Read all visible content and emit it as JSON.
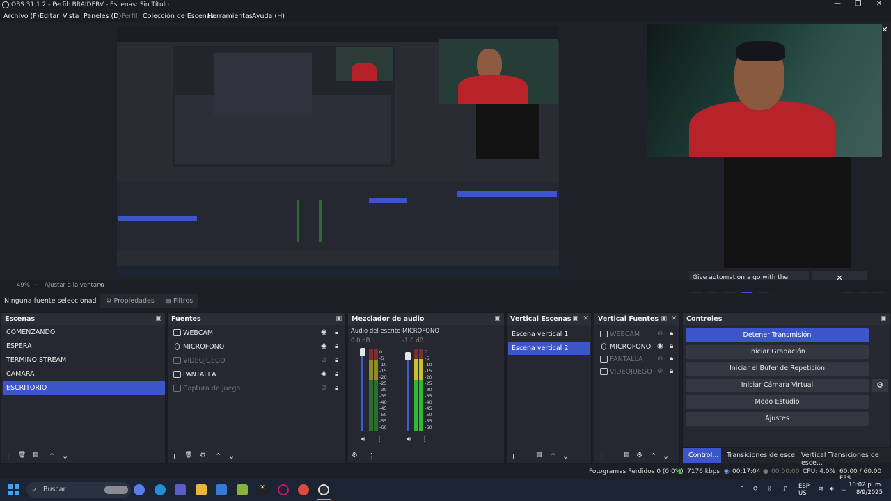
{
  "window": {
    "title": "OBS 31.1.2 - Perfil: BRAIDERV - Escenas: Sin Título",
    "minimize": "—",
    "maximize": "❐",
    "close": "✕"
  },
  "menu": [
    "Archivo (F)",
    "Editar",
    "Vista",
    "Paneles (D)",
    "Perfil",
    "Colección de Escenas",
    "Herramientas",
    "Ayuda (H)"
  ],
  "preview": {
    "ad_text": "Give automation a go with the Altum App",
    "ad_close": "✕",
    "close_icon": "✕",
    "zoom": "49%",
    "zoom_minus": "−",
    "zoom_plus": "+",
    "zoom_fit": "Ajustar a la ventana",
    "zoom_caret": "▾"
  },
  "props": {
    "selection": "Ninguna fuente seleccionad",
    "properties": "Propiedades",
    "filters": "Filtros"
  },
  "docks": {
    "scenes": {
      "title": "Escenas",
      "items": [
        "COMENZANDO",
        "ESPERA",
        "TERMINO STREAM",
        "CAMARA",
        "ESCRITORIO"
      ],
      "selected": "ESCRITORIO"
    },
    "sources": {
      "title": "Fuentes",
      "items": [
        {
          "name": "WEBCAM",
          "visible": true
        },
        {
          "name": "MICROFONO",
          "visible": true
        },
        {
          "name": "VIDEOJUEGO",
          "visible": false
        },
        {
          "name": "PANTALLA",
          "visible": true
        },
        {
          "name": "Captura de juego",
          "visible": false
        }
      ]
    },
    "mixer": {
      "title": "Mezclador de audio",
      "channels": [
        {
          "name": "Audio del escritorio",
          "level": "0.0 dB"
        },
        {
          "name": "MICROFONO",
          "level": "-1.0 dB"
        }
      ],
      "ticks": [
        "0",
        "-5",
        "-10",
        "-15",
        "-20",
        "-25",
        "-30",
        "-35",
        "-40",
        "-45",
        "-50",
        "-55",
        "-60"
      ]
    },
    "vscenes": {
      "title": "Vertical Escenas",
      "items": [
        "Escena vertical 1",
        "Escena vertical 2"
      ],
      "selected": "Escena vertical 2"
    },
    "vsources": {
      "title": "Vertical Fuentes",
      "items": [
        {
          "name": "WEBCAM",
          "visible": false
        },
        {
          "name": "MICROFONO",
          "visible": true
        },
        {
          "name": "PANTALLA",
          "visible": false
        },
        {
          "name": "VIDEOJUEGO",
          "visible": false
        }
      ]
    },
    "controls": {
      "title": "Controles",
      "buttons": [
        "Detener Transmisión",
        "Iniciar Grabación",
        "Iniciar el Búfer de Repetición",
        "Iniciar Cámara Virtual",
        "Modo Estudio",
        "Ajustes"
      ],
      "tabs": [
        "Control...",
        "Transiciones de esce...",
        "Vertical Transiciones de esce..."
      ]
    }
  },
  "status": {
    "dropped": "Fotogramas Perdidos 0 (0.0%)",
    "kbps": "7176 kbps",
    "stream_time": "00:17:04",
    "rec_time": "00:00:00",
    "cpu": "CPU: 4.0%",
    "fps": "60.00 / 60.00 FPS"
  },
  "taskbar": {
    "search": "Buscar",
    "lang1": "ESP",
    "lang2": "US",
    "time": "10:02 p. m.",
    "date": "8/9/2025"
  },
  "colors": {
    "accent": "#3c55c8",
    "bg": "#1d1f26",
    "panel": "#262831"
  }
}
